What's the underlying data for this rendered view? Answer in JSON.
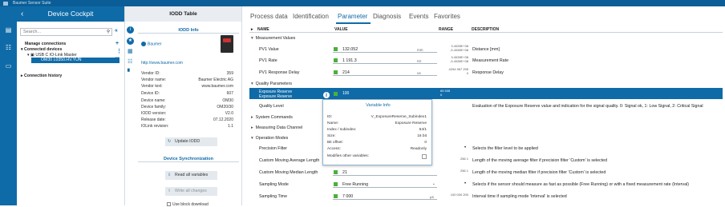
{
  "app": {
    "title": "Baumer Sensor Suite"
  },
  "cockpit": {
    "title": "Device Cockpit",
    "search_placeholder": "Search...",
    "manage": "Manage connections",
    "connected": "Connected devices",
    "master": "USB C IO-Link Master",
    "device": "OM30 L0350.HV.YUN",
    "history": "Connection history"
  },
  "iodd": {
    "title": "IODD Table",
    "info_title": "IODD Info",
    "brand": "Baumer",
    "url": "http://www.baumer.com",
    "rows": [
      {
        "label": "Vendor ID:",
        "value": "359"
      },
      {
        "label": "Vendor name:",
        "value": "Baumer Electric AG"
      },
      {
        "label": "Vendor text:",
        "value": "www.baumer.com"
      },
      {
        "label": "Device ID:",
        "value": "607"
      },
      {
        "label": "Device name:",
        "value": "OM30"
      },
      {
        "label": "Device family:",
        "value": "OM20/30"
      },
      {
        "label": "IODD version:",
        "value": "V2.0"
      },
      {
        "label": "Release date:",
        "value": "07.12.2020"
      },
      {
        "label": "IOLink revision:",
        "value": "1.1"
      }
    ],
    "update_btn": "Update IODD",
    "sync_title": "Device Synchronization",
    "read_btn": "Read all variables",
    "write_btn": "Write all changes",
    "block_label": "Use block download"
  },
  "tabs": [
    "Process data",
    "Identification",
    "Parameter",
    "Diagnosis",
    "Events",
    "Favorites"
  ],
  "table": {
    "headers": [
      "NAME",
      "VALUE",
      "RANGE",
      "DESCRIPTION"
    ],
    "measurement_group": "Measurement Values",
    "measurement": [
      {
        "name": "PV1 Value",
        "value": "132.052",
        "unit": "mm",
        "range1": "3.4028E+38",
        "range2": "-3.4028E+38",
        "desc": "Distance [mm]"
      },
      {
        "name": "PV1 Rate",
        "value": "1 191.3",
        "unit": "Hz",
        "range1": "3.4028E+38",
        "range2": "-3.4028E+38",
        "desc": "Measurement Rate"
      },
      {
        "name": "PV1 Response Delay",
        "value": "214",
        "unit": "us",
        "range1": "4294 967 295",
        "range2": "0",
        "desc": "Response Delay"
      }
    ],
    "quality_group": "Quality Parameters",
    "selected": {
      "name1": "Exposure Reserve",
      "name2": "Exposure Reserve",
      "value": "100",
      "range1": "65 535",
      "range2": "0"
    },
    "quality_level": "Quality Level",
    "quality_desc": "Evaluation of the Exposure Reserve value and indication for the signal quality. 0: Signal ok, 1: Low Signal, 2: Critical Signal",
    "system_group": "System Commands",
    "mdc_group": "Measuring Data Channel",
    "op_group": "Operation Modes",
    "op_rows": [
      {
        "name": "Precision Filter",
        "value": "",
        "range": "",
        "desc": "Selects the filter level to be applied"
      },
      {
        "name": "Custom Moving Average Length",
        "value": "",
        "range": "256 1",
        "desc": "Length of the moving average filter if precision filter 'Custom' is selected"
      },
      {
        "name": "Custom Moving Median Length",
        "value": "21",
        "range": "256 1",
        "desc": "Length of the moving median filter if precision filter 'Custom' is selected"
      },
      {
        "name": "Sampling Mode",
        "value": "Free Running",
        "range": "",
        "desc": "Selects if the sensor should measure as fast as possible (Free Running) or with a fixed measurement rate (Interval)"
      },
      {
        "name": "Sampling Time",
        "value": "7 000",
        "unit": "µs",
        "range": "100 000 200",
        "desc": "Interval time if sampling mode 'Interval' is selected"
      }
    ]
  },
  "popup": {
    "title": "Variable Info",
    "rows": [
      {
        "label": "ID:",
        "value": "V_ExposureReserve_Subindex1"
      },
      {
        "label": "Name:",
        "value": "Exposure Reserve"
      },
      {
        "label": "Index / subindex:",
        "value": "64/1"
      },
      {
        "label": "Size:",
        "value": "16 bit"
      },
      {
        "label": "Bit offset:",
        "value": "0"
      },
      {
        "label": "Access:",
        "value": "Readonly"
      }
    ],
    "modifies": "Modifies other variables:"
  }
}
